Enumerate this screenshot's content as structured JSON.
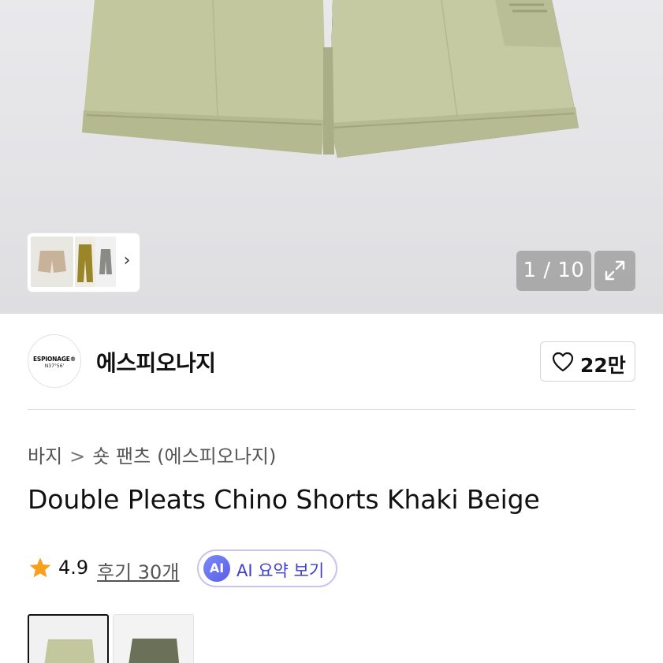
{
  "gallery": {
    "counter": "1 / 10",
    "main_color": "#c2c79e"
  },
  "brand": {
    "logo_line1": "ESPIONAGE®",
    "logo_line2": "N37°56'",
    "name": "에스피오나지",
    "like_count": "22만"
  },
  "breadcrumb": {
    "category": "바지",
    "separator": ">",
    "subcategory": "숏 팬츠",
    "brand_suffix": "(에스피오나지)"
  },
  "product": {
    "title": "Double Pleats Chino Shorts Khaki Beige"
  },
  "rating": {
    "score": "4.9",
    "reviews_link": "후기 30개",
    "ai_badge": "AI",
    "ai_button": "AI 요약 보기"
  },
  "colors": {
    "accent": "#5a5de8",
    "star": "#f5a11c",
    "swatch1": "#c2c79e",
    "swatch2": "#6b7158"
  }
}
